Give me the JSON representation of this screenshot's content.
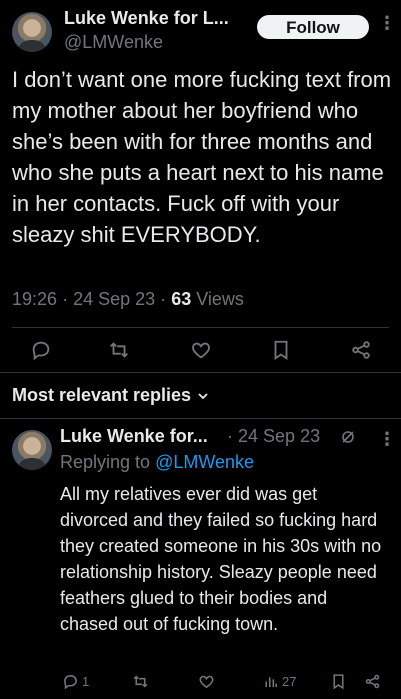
{
  "tweet": {
    "author_name": "Luke Wenke for L...",
    "author_handle": "@LMWenke",
    "follow_label": "Follow",
    "text": "I don’t want one more fucking text from my mother about her boyfriend who she’s been with for three months and who she puts a heart next to his name in her contacts.  Fuck off with your sleazy shit EVERYBODY.",
    "time": "19:26",
    "date": "24 Sep 23",
    "separator": "·",
    "views_count": "63",
    "views_label": "Views",
    "actions": [
      "reply-icon",
      "retweet-icon",
      "like-icon",
      "bookmark-icon",
      "share-icon"
    ]
  },
  "replies_section": {
    "title": "Most relevant replies",
    "chevron": "chevron-down-icon"
  },
  "reply": {
    "author_name": "Luke Wenke for...",
    "separator": "·",
    "date": "24 Sep 23",
    "replying_to_label": "Replying to",
    "replying_to_handle": "@LMWenke",
    "text": "All my relatives ever did was get divorced and they failed so fucking hard they created someone in his 30s with no relationship history. Sleazy people need feathers glued to their bodies and chased out of fucking town.",
    "reply_count": "1",
    "views_count": "27",
    "actions": [
      "reply-icon",
      "retweet-icon",
      "like-icon",
      "views-icon",
      "bookmark-icon",
      "share-icon"
    ]
  },
  "colors": {
    "background": "#000000",
    "text": "#e7e9ea",
    "muted": "#71767b",
    "link": "#1d9bf0",
    "divider": "#2f3336",
    "button_bg": "#eff3f4"
  }
}
